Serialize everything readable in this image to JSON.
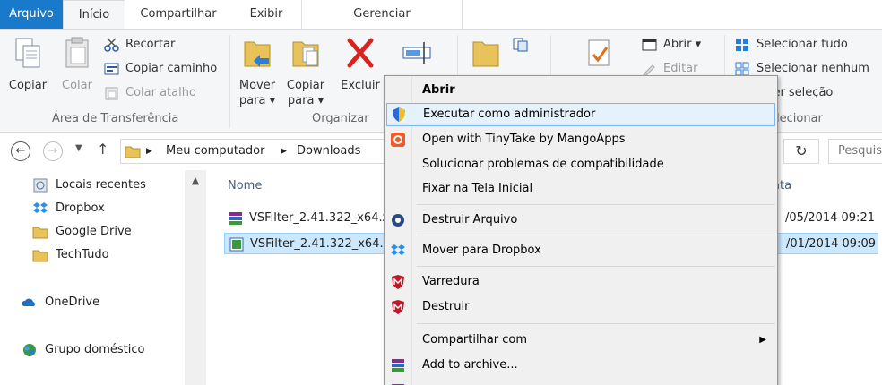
{
  "tabs": {
    "arquivo": "Arquivo",
    "inicio": "Início",
    "compartilhar": "Compartilhar",
    "exibir": "Exibir",
    "gerenciar": "Gerenciar"
  },
  "ribbon": {
    "copiar": "Copiar",
    "colar": "Colar",
    "recortar": "Recortar",
    "copiar_caminho": "Copiar caminho",
    "colar_atalho": "Colar atalho",
    "area_transferencia": "Área de Transferência",
    "mover_para_1": "Mover",
    "mover_para_2": "para ▾",
    "copiar_para_1": "Copiar",
    "copiar_para_2": "para ▾",
    "excluir": "Excluir",
    "organizar": "Organizar",
    "abrir": "Abrir ▾",
    "editar": "Editar",
    "selecionar_tudo": "Selecionar tudo",
    "selecionar_nenhum": "Selecionar nenhum",
    "inverter_selecao": "erter seleção",
    "selecionar_group": "lecionar"
  },
  "address": {
    "crumb1": "Meu computador",
    "crumb2": "Downloads",
    "search_placeholder": "Pesquis"
  },
  "nav": {
    "items": [
      "Locais recentes",
      "Dropbox",
      "Google Drive",
      "TechTudo",
      "OneDrive",
      "Grupo doméstico"
    ]
  },
  "files": {
    "col_name": "Nome",
    "col_date": "ata",
    "rows": [
      {
        "name": "VSFilter_2.41.322_x64.z",
        "date": "/05/2014 09:21"
      },
      {
        "name": "VSFilter_2.41.322_x64.e",
        "date": "/01/2014 09:09"
      }
    ]
  },
  "context_menu": {
    "abrir": "Abrir",
    "executar_admin": "Executar como administrador",
    "tinytake": "Open with TinyTake by MangoApps",
    "solucionar": "Solucionar problemas de compatibilidade",
    "fixar": "Fixar na Tela Inicial",
    "destruir_arquivo": "Destruir Arquivo",
    "mover_dropbox": "Mover para Dropbox",
    "varredura": "Varredura",
    "destruir": "Destruir",
    "compartilhar_com": "Compartilhar com",
    "add_archive": "Add to archive..."
  },
  "colors": {
    "accent": "#1979ca",
    "selection": "#cce8ff",
    "menu_hover": "#e5f1fb"
  }
}
